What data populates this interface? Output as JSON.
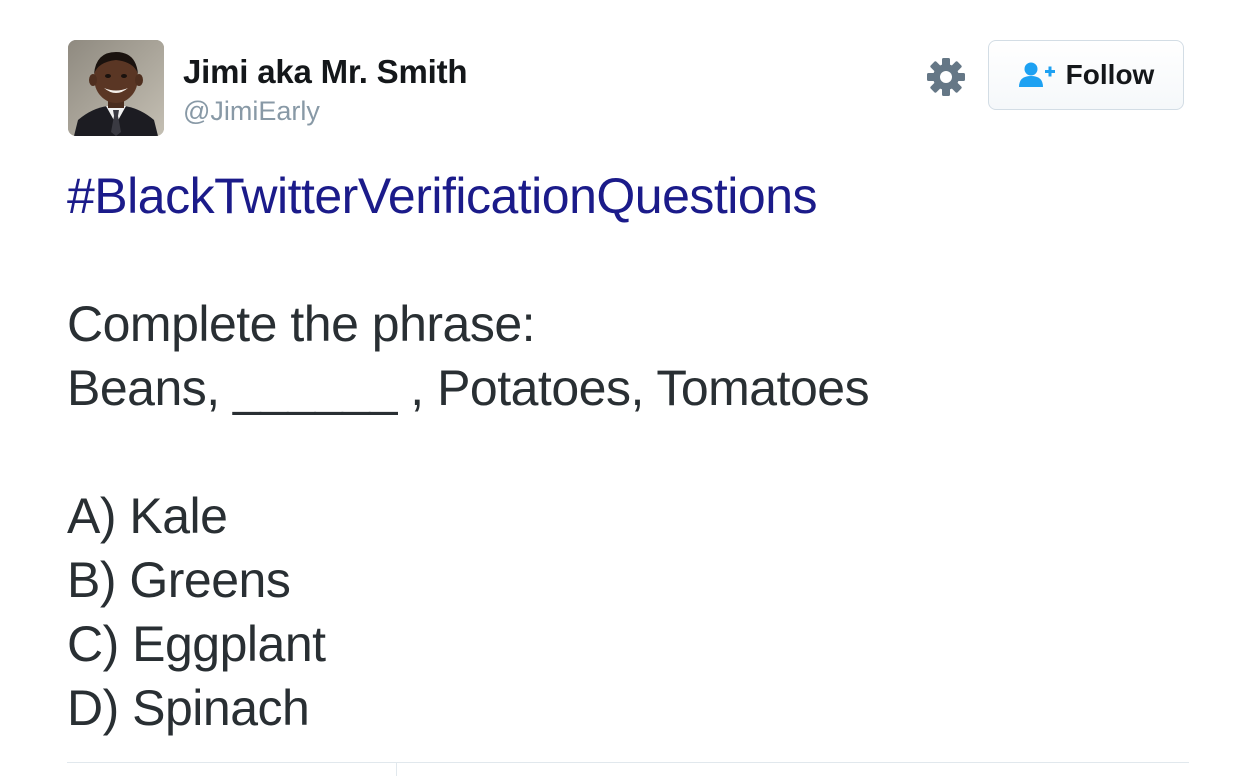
{
  "user": {
    "display_name": "Jimi aka Mr. Smith",
    "screen_name": "@JimiEarly",
    "avatar": "profile-photo"
  },
  "actions": {
    "settings_icon": "gear-icon",
    "follow_icon": "person-plus-icon",
    "follow_label": "Follow",
    "accent_color": "#1da1f2"
  },
  "tweet": {
    "hashtag": "#BlackTwitterVerificationQuestions",
    "hashtag_color": "#1b1b8a",
    "prompt": "Complete the phrase:",
    "phrase": "Beans, ______ , Potatoes, Tomatoes",
    "options": [
      "A) Kale",
      "B) Greens",
      "C) Eggplant",
      "D) Spinach"
    ]
  }
}
